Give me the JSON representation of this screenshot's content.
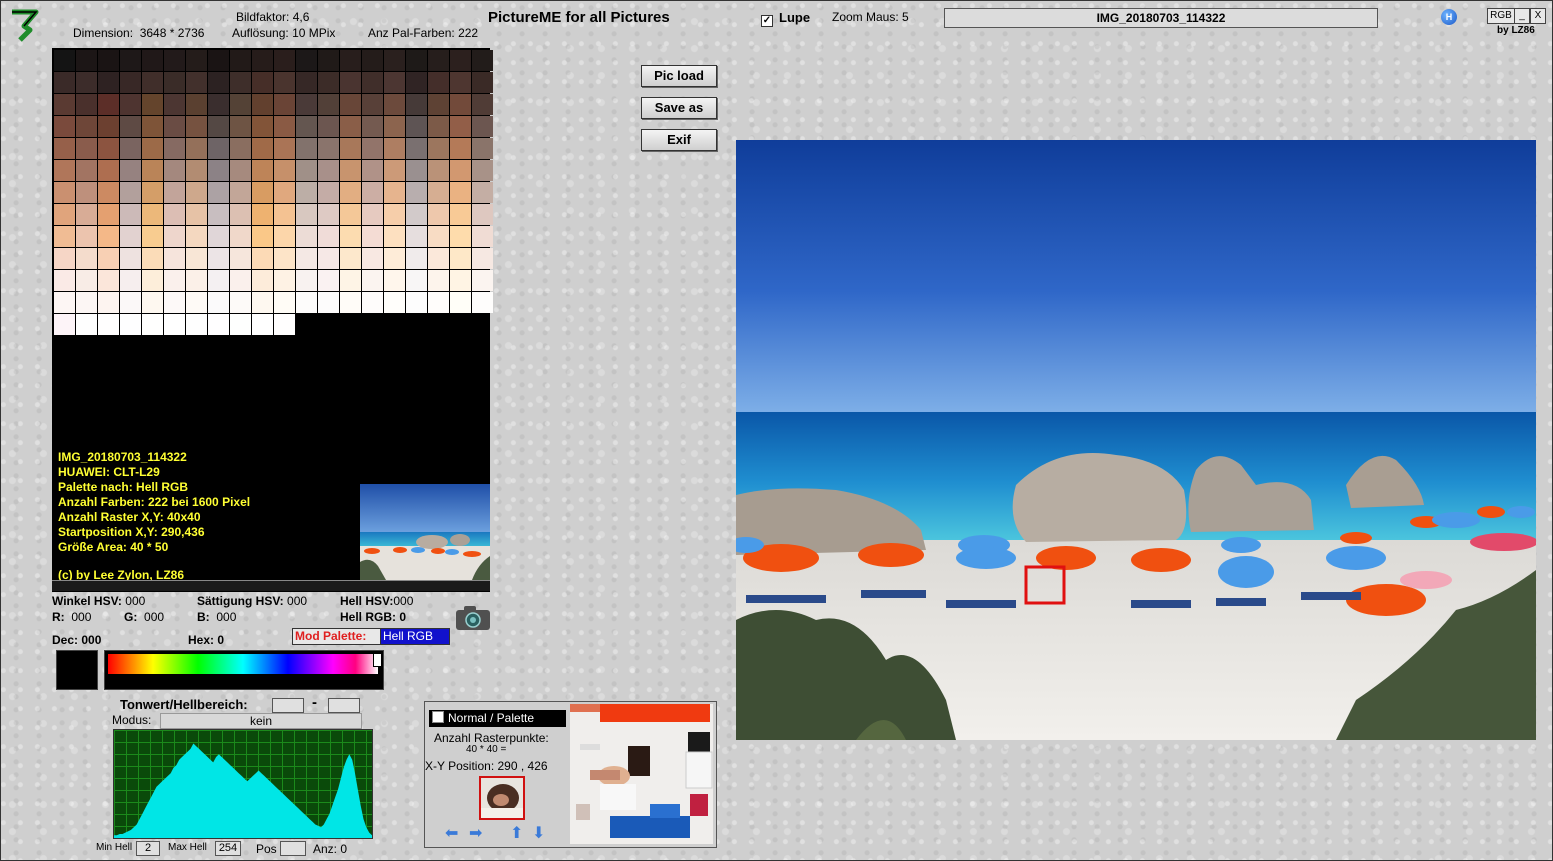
{
  "header": {
    "bildfaktor_label": "Bildfaktor:",
    "bildfaktor_value": "4,6",
    "dimension_label": "Dimension:",
    "dimension_value": "3648 * 2736",
    "aufloesung_label": "Auflösung:",
    "aufloesung_value": "10 MPix",
    "pal_label": "Anz Pal-Farben:",
    "pal_value": "222",
    "app_title": "PictureME for all Pictures",
    "lupe_label": "Lupe",
    "lupe_checked_mark": "✓",
    "zoom_label": "Zoom Maus:",
    "zoom_value": "5",
    "filename": "IMG_20180703_114322",
    "h_badge": "H",
    "rgb_button": "RGB",
    "min_button": "_",
    "close_button": "X",
    "byline": "by LZ86"
  },
  "buttons": {
    "pic_load": "Pic load",
    "save_as": "Save as",
    "exif": "Exif"
  },
  "info": {
    "line1": "IMG_20180703_114322",
    "line2": "HUAWEI: CLT-L29",
    "line3": "Palette nach: Hell RGB",
    "line4": "Anzahl Farben: 222  bei 1600 Pixel",
    "line5": "Anzahl Raster X,Y: 40x40",
    "line6": "Startposition X,Y: 290,436",
    "line7": "Größe Area: 40 * 50",
    "line8": "(c) by Lee Zylon, LZ86"
  },
  "values": {
    "winkel_label": "Winkel HSV:",
    "winkel_value": "000",
    "saett_label": "Sättigung HSV:",
    "saett_value": "000",
    "hell_label": "Hell HSV:",
    "hell_value": "000",
    "r_label": "R:",
    "r_value": "000",
    "g_label": "G:",
    "g_value": "000",
    "b_label": "B:",
    "b_value": "000",
    "hellrgb_label": "Hell RGB:",
    "hellrgb_value": "0",
    "dec_label": "Dec:",
    "dec_value": "000",
    "hex_label": "Hex:",
    "hex_value": "0",
    "mod_palette_label": "Mod Palette:",
    "mod_palette_value": "Hell RGB"
  },
  "tonwert": {
    "title": "Tonwert/Hellbereich:",
    "dash": "-",
    "modus_label": "Modus:",
    "modus_value": "kein",
    "min_hell_label": "Min Hell",
    "min_hell_value": "2",
    "max_hell_label": "Max Hell",
    "max_hell_value": "254",
    "pos_label": "Pos",
    "anz_label": "Anz:",
    "anz_value": "0"
  },
  "zoom_panel": {
    "mode_label": "Normal / Palette",
    "raster_label": "Anzahl Rasterpunkte:",
    "raster_value": "40 * 40 =",
    "xy_label": "X-Y Position:",
    "xy_value": "290 , 426"
  },
  "palette_rows": [
    [
      "#141414",
      "#1c1616",
      "#1a1414",
      "#1e1818",
      "#201818",
      "#221a1a",
      "#241c1a",
      "#1a1414",
      "#221a18",
      "#261c1a",
      "#2a1e1c",
      "#1c1818",
      "#201a18",
      "#281e1c",
      "#241c1a",
      "#2a201e",
      "#1e1a18",
      "#261e1c",
      "#2c201e",
      "#221c1a"
    ],
    [
      "#3a2a28",
      "#3c2c2a",
      "#2e2222",
      "#382826",
      "#402e2a",
      "#3a2c28",
      "#42302c",
      "#2c2222",
      "#3e2e2a",
      "#462e28",
      "#4a342e",
      "#362826",
      "#3c2c28",
      "#4a3430",
      "#402e2a",
      "#4c3632",
      "#302424",
      "#442e2a",
      "#4e3630",
      "#3a2a26"
    ],
    [
      "#5a3a32",
      "#4a302c",
      "#5c2e28",
      "#4e3430",
      "#64442c",
      "#4c3632",
      "#5a4030",
      "#3a2e2e",
      "#544236",
      "#62402e",
      "#6a4436",
      "#4a3a38",
      "#524038",
      "#684638",
      "#584038",
      "#6c4a3c",
      "#463a38",
      "#5e4234",
      "#724a3a",
      "#503c36"
    ],
    [
      "#7a4a3c",
      "#6e4638",
      "#6c4030",
      "#5e4a44",
      "#7e5438",
      "#6a4c44",
      "#765240",
      "#544844",
      "#6e5444",
      "#825438",
      "#8a5a44",
      "#645650",
      "#6c5650",
      "#8a5e48",
      "#745a50",
      "#8c644e",
      "#5e5454",
      "#7c5a48",
      "#925e48",
      "#6c5650"
    ],
    [
      "#96604a",
      "#8a5c4c",
      "#8c5440",
      "#7a6460",
      "#9c6a48",
      "#866a62",
      "#94705a",
      "#6e6466",
      "#8a6e60",
      "#a06a48",
      "#aa7456",
      "#82726c",
      "#8a746c",
      "#a8785a",
      "#92746a",
      "#ae7e62",
      "#7a7070",
      "#9c765e",
      "#b47a58",
      "#8a746a"
    ],
    [
      "#b0765a",
      "#a27462",
      "#ae6e50",
      "#968280",
      "#ba8458",
      "#a4887e",
      "#b28c72",
      "#8c8286",
      "#a68a7e",
      "#be8458",
      "#c6906a",
      "#a09088",
      "#a8908a",
      "#c8946e",
      "#b09288",
      "#cc9a78",
      "#9a9090",
      "#ba9278",
      "#d29870",
      "#a89288"
    ],
    [
      "#ca9070",
      "#be907c",
      "#cc8a62",
      "#b2a09c",
      "#d49e68",
      "#c2a49a",
      "#cea88c",
      "#aca2a4",
      "#c2a698",
      "#d89c62",
      "#e0a87e",
      "#bcaea6",
      "#c4aca6",
      "#e2ae82",
      "#ccaea4",
      "#e6b48e",
      "#b8aeae",
      "#d6ae92",
      "#eab282",
      "#c4aea4"
    ],
    [
      "#e0a47c",
      "#d8ac96",
      "#e4a070",
      "#ccbab8",
      "#ecb87a",
      "#dcbeb4",
      "#e6c2a6",
      "#c8bec0",
      "#dcc0b2",
      "#eeb270",
      "#f4c292",
      "#d8c8c0",
      "#decac4",
      "#f4c898",
      "#e6cac0",
      "#f6ceaa",
      "#d2caca",
      "#eec8ac",
      "#f8ca96",
      "#dec8c0"
    ],
    [
      "#f0bc94",
      "#ecc4ae",
      "#f4b888",
      "#e2d2d0",
      "#f8cc90",
      "#eed6cc",
      "#f4d8c0",
      "#e0d6d8",
      "#f0d8ca",
      "#fac888",
      "#fcd6aa",
      "#ecdcd6",
      "#f0dcd8",
      "#fcdcb0",
      "#f4dcd4",
      "#fde0c0",
      "#e6dede",
      "#f8dcc4",
      "#fedcac",
      "#f0dcd4"
    ],
    [
      "#f6d6c6",
      "#f4dccc",
      "#f8d0b4",
      "#eee2e0",
      "#fbdcb8",
      "#f6e4dc",
      "#f8e6d6",
      "#ece4e6",
      "#f6e6dc",
      "#fcdab6",
      "#fde4c8",
      "#f4e8e4",
      "#f6e8e6",
      "#fde8cc",
      "#f8e8e2",
      "#feecd8",
      "#f0ebeb",
      "#fbe8da",
      "#fee8c8",
      "#f6e8e2"
    ],
    [
      "#faeae6",
      "#f8ece6",
      "#fbe6da",
      "#f6eeee",
      "#fdeeda",
      "#faf0ec",
      "#fbf0e8",
      "#f4f0f2",
      "#faf0ec",
      "#fdecda",
      "#fef2e4",
      "#f8f2f0",
      "#faf2f2",
      "#fef4e6",
      "#fbf4f0",
      "#fff6ec",
      "#f8f6f6",
      "#fdf4ec",
      "#fff4e4",
      "#fbf4f0"
    ],
    [
      "#fdf6f4",
      "#fcf6f4",
      "#fdf4f0",
      "#fbf8f8",
      "#fef8f0",
      "#fdf9f8",
      "#fefaf6",
      "#fbfafb",
      "#fdfaf8",
      "#fef8f0",
      "#fffcf6",
      "#fdfcfb",
      "#fdfcfc",
      "#fffcf8",
      "#fefcfb",
      "#fffefb",
      "#fdfdfd",
      "#fffdfb",
      "#fffef8",
      "#fefdfc"
    ],
    [
      "#fdf4f8",
      "#fefefe",
      "#fffefe",
      "#fefeff",
      "#fffffe",
      "#ffffff",
      "#fefefe",
      "#fffeff",
      "#fefffe",
      "#ffffff",
      "#fffefe"
    ]
  ],
  "colors": {
    "info_text": "#ffff33",
    "mod_label_text": "#e02020",
    "mod_value_bg": "#1111cc",
    "histogram_fill": "#00e6e6",
    "marker_red": "#d01010"
  },
  "histogram": [
    2,
    2,
    3,
    3,
    4,
    5,
    6,
    8,
    10,
    14,
    18,
    22,
    26,
    30,
    34,
    38,
    40,
    42,
    44,
    46,
    48,
    52,
    54,
    58,
    60,
    62,
    64,
    66,
    70,
    68,
    66,
    64,
    62,
    60,
    58,
    56,
    60,
    62,
    60,
    58,
    56,
    54,
    52,
    50,
    48,
    46,
    44,
    42,
    44,
    46,
    48,
    50,
    48,
    46,
    44,
    42,
    40,
    38,
    36,
    34,
    32,
    30,
    28,
    26,
    24,
    22,
    20,
    18,
    16,
    14,
    12,
    10,
    9,
    8,
    10,
    14,
    18,
    24,
    30,
    36,
    44,
    52,
    58,
    62,
    58,
    48,
    36,
    24,
    14,
    8,
    4,
    2
  ]
}
